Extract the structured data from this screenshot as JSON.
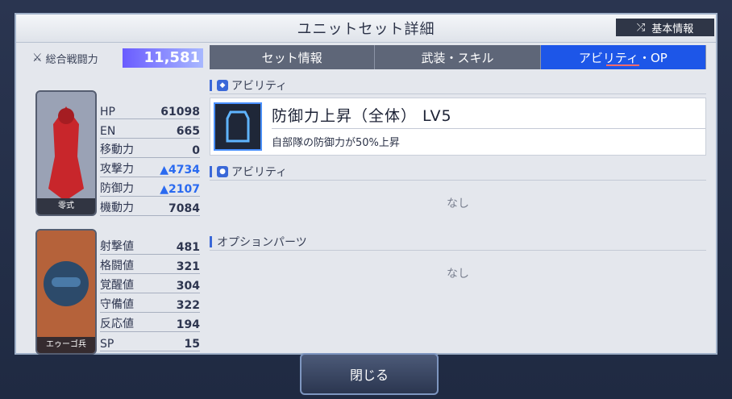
{
  "header": {
    "title": "ユニットセット詳細",
    "basic_info": "基本情報"
  },
  "power": {
    "label": "総合戦闘力",
    "value": "11,581"
  },
  "unit": {
    "caption": "零式",
    "stats": [
      {
        "label": "HP",
        "value": "61098"
      },
      {
        "label": "EN",
        "value": "665"
      },
      {
        "label": "移動力",
        "value": "0"
      },
      {
        "label": "攻撃力",
        "value": "▲4734"
      },
      {
        "label": "防御力",
        "value": "▲2107"
      },
      {
        "label": "機動力",
        "value": "7084"
      }
    ]
  },
  "pilot": {
    "caption": "エゥーゴ兵",
    "stats": [
      {
        "label": "射撃値",
        "value": "481"
      },
      {
        "label": "格闘値",
        "value": "321"
      },
      {
        "label": "覚醒値",
        "value": "304"
      },
      {
        "label": "守備値",
        "value": "322"
      },
      {
        "label": "反応値",
        "value": "194"
      },
      {
        "label": "SP",
        "value": "15"
      }
    ]
  },
  "tabs": [
    {
      "label": "セット情報",
      "active": false
    },
    {
      "label": "武装・スキル",
      "active": false
    },
    {
      "label": "アビリティ・OP",
      "active": true
    }
  ],
  "sections": {
    "unit_ability": {
      "title": "アビリティ",
      "name": "防御力上昇（全体） LV5",
      "desc": "自部隊の防御力が50%上昇"
    },
    "pilot_ability": {
      "title": "アビリティ",
      "value": "なし"
    },
    "option_parts": {
      "title": "オプションパーツ",
      "value": "なし"
    }
  },
  "footer": {
    "close": "閉じる"
  }
}
